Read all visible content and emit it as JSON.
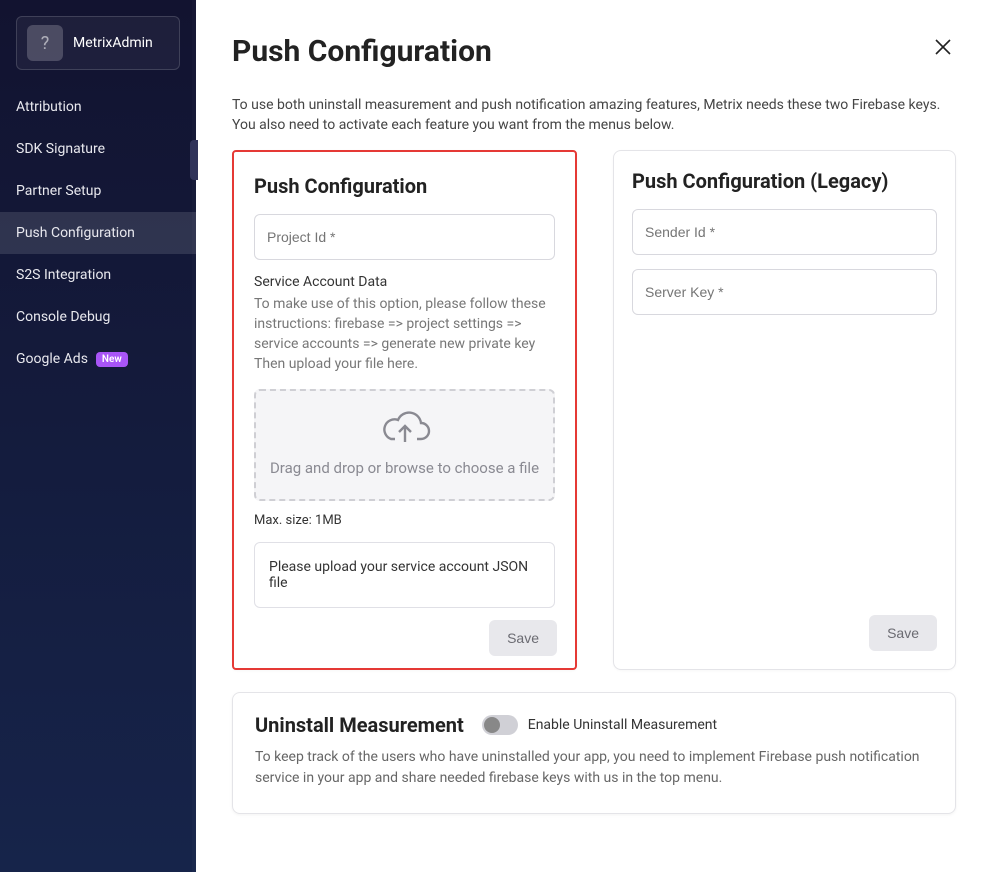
{
  "sidebar": {
    "brand": "MetrixAdmin",
    "avatar_glyph": "?",
    "items": [
      {
        "label": "Attribution"
      },
      {
        "label": "SDK Signature"
      },
      {
        "label": "Partner Setup"
      },
      {
        "label": "Push Configuration"
      },
      {
        "label": "S2S Integration"
      },
      {
        "label": "Console Debug"
      },
      {
        "label": "Google Ads",
        "badge": "New"
      }
    ],
    "active_index": 3
  },
  "page": {
    "title": "Push Configuration",
    "description": "To use both uninstall measurement and push notification amazing features, Metrix needs these two Firebase keys. You also need to activate each feature you want from the menus below."
  },
  "push_card": {
    "title": "Push Configuration",
    "project_id_label": "Project Id *",
    "service_account_label": "Service Account Data",
    "service_account_help": "To make use of this option, please follow these instructions: firebase => project settings => service accounts => generate new private key Then upload your file here.",
    "dropzone_text": "Drag and drop or browse to choose a file",
    "max_size_hint": "Max. size: 1MB",
    "upload_note": "Please upload your service account JSON file",
    "save_label": "Save"
  },
  "legacy_card": {
    "title": "Push Configuration (Legacy)",
    "sender_id_label": "Sender Id *",
    "server_key_label": "Server Key *",
    "save_label": "Save"
  },
  "uninstall": {
    "title": "Uninstall Measurement",
    "toggle_label": "Enable Uninstall Measurement",
    "description": "To keep track of the users who have uninstalled your app, you need to implement Firebase push notification service in your app and share needed firebase keys with us in the top menu."
  }
}
